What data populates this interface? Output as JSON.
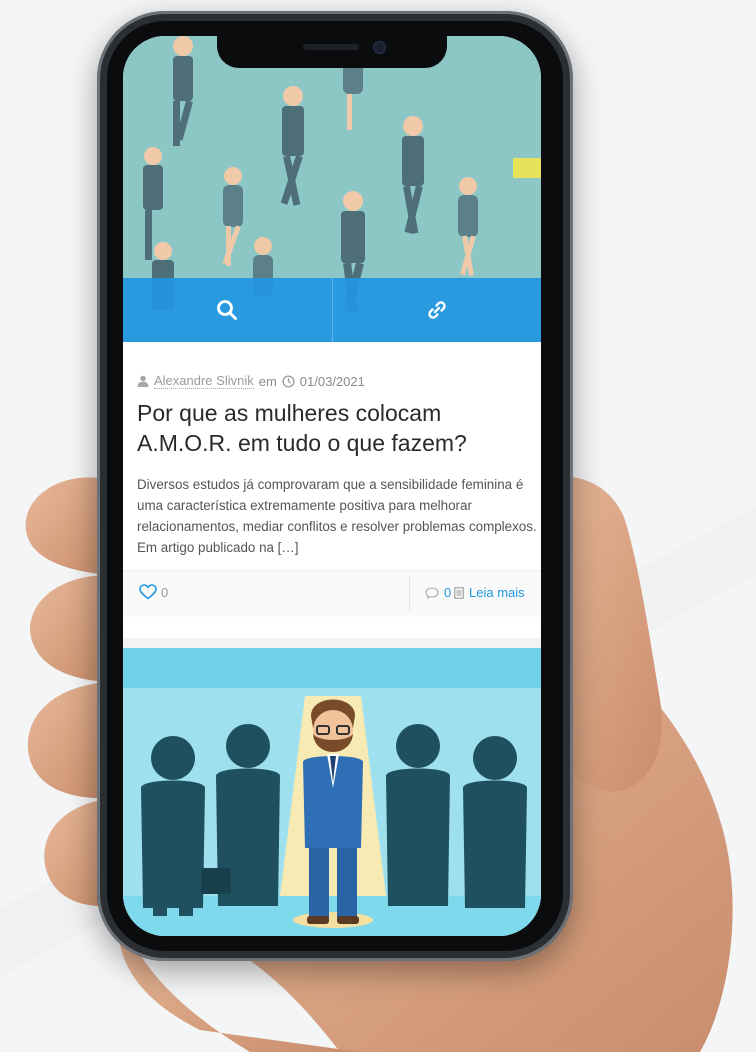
{
  "post": {
    "author": "Alexandre Slivnik",
    "author_suffix": "em",
    "date": "01/03/2021",
    "title": "Por que as mulheres colocam A.M.O.R. em tudo o que fazem?",
    "excerpt": "Diversos estudos já comprovaram que a sensibilidade feminina é uma característica extremamente positiva para melhorar relacionamentos, mediar conflitos e resolver problemas complexos. Em artigo publicado na […]",
    "likes": "0",
    "comments": "0",
    "read_more": "Leia mais"
  },
  "icons": {
    "zoom": "search-icon",
    "link": "link-icon",
    "author": "user-icon",
    "date": "clock-icon",
    "like": "heart-icon",
    "comment": "comment-icon",
    "read": "document-icon"
  },
  "colors": {
    "accent": "#2196e2",
    "hero_bg": "#8cc7c6",
    "hero2_bg": "#6fd1ea"
  }
}
